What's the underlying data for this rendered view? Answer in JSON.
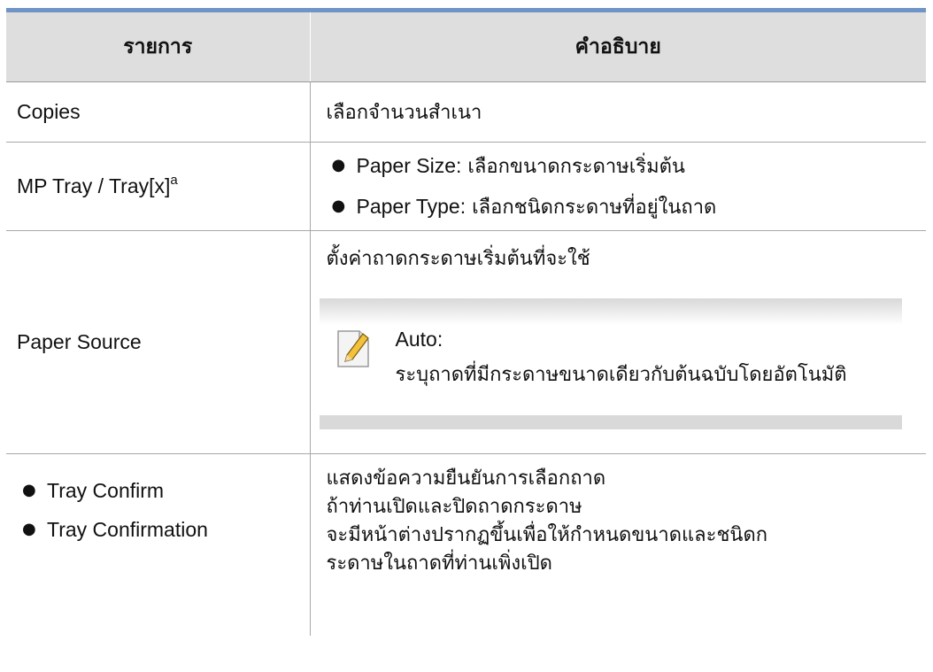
{
  "table": {
    "headers": [
      "รายการ",
      "คำอธิบาย"
    ],
    "rows": [
      {
        "item": "Copies",
        "description": "เลือกจำนวนสำเนา"
      },
      {
        "item": "MP Tray / Tray[x]",
        "item_sup": "a",
        "bullets": [
          {
            "term": "Paper Size:",
            "text": " เลือกขนาดกระดาษเริ่มต้น"
          },
          {
            "term": "Paper Type:",
            "text": " เลือกชนิดกระดาษที่อยู่ในถาด"
          }
        ]
      },
      {
        "item": "Paper Source",
        "description": "ตั้งค่าถาดกระดาษเริ่มต้นที่จะใช้",
        "note": {
          "title": "Auto:",
          "text": "ระบุถาดที่มีกระดาษขนาดเดียวกับต้นฉบับโดยอัตโนมัติ"
        }
      },
      {
        "items": [
          "Tray Confirm",
          "Tray Confirmation"
        ],
        "description_lines": [
          "แสดงข้อความยืนยันการเลือกถาด",
          "ถ้าท่านเปิดและปิดถาดกระดาษ",
          "จะมีหน้าต่างปรากฏขึ้นเพื่อให้กำหนดขนาดและชนิดก",
          "ระดาษในถาดที่ท่านเพิ่งเปิด"
        ]
      }
    ]
  },
  "icons": {
    "note": "note-pencil-icon"
  },
  "colors": {
    "accent_bar": "#6f94c6",
    "header_bg": "#dedede"
  }
}
